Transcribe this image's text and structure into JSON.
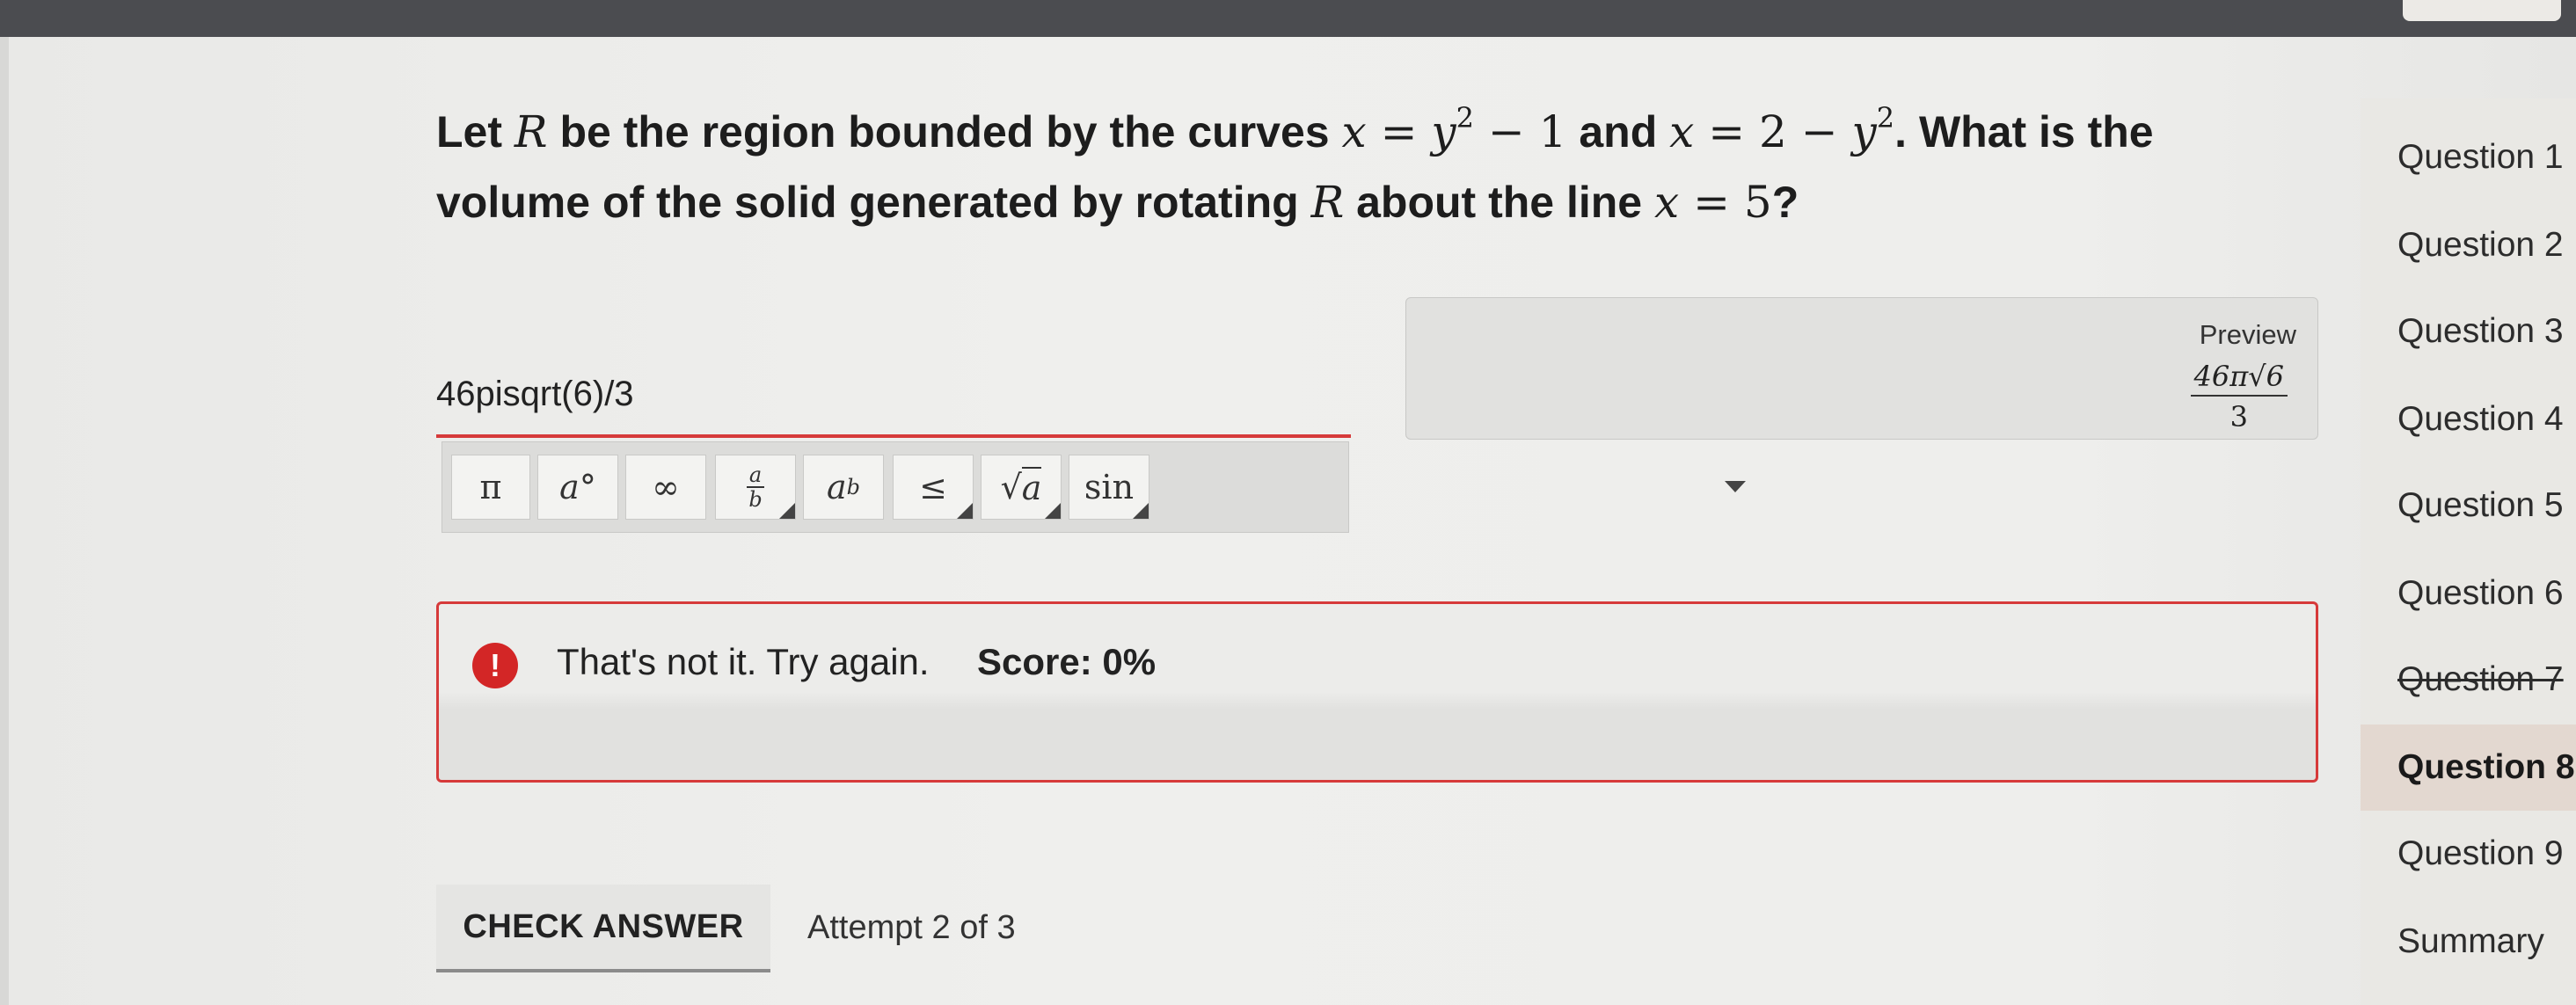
{
  "question": {
    "part1": "Let ",
    "var_R": "R",
    "part2": " be the region bounded by the curves ",
    "eq1_lhs": "x",
    "eq1_mid": " = ",
    "eq1_y": "y",
    "eq1_exp": "2",
    "eq1_rest": " − 1",
    "part3": " and ",
    "eq2_lhs": "x",
    "eq2_mid": " = 2 − ",
    "eq2_y": "y",
    "eq2_exp": "2",
    "part4": ". What is the",
    "part5": "volume of the solid generated by rotating ",
    "var_R2": "R",
    "part6": " about the line ",
    "eq3_lhs": "x",
    "eq3_rest": " = 5",
    "part7": "?"
  },
  "answer": {
    "value": "46pisqrt(6)/3"
  },
  "toolbar": {
    "pi": "π",
    "degree_base": "a",
    "degree_sym": "°",
    "infinity": "∞",
    "frac_num": "a",
    "frac_den": "b",
    "power_base": "a",
    "power_exp": "b",
    "leq": "≤",
    "sqrt_sym": "√",
    "sqrt_arg": "a",
    "sin": "sin"
  },
  "preview": {
    "label": "Preview",
    "numerator": "46π√6",
    "denominator": "3"
  },
  "feedback": {
    "icon": "!",
    "message": "That's not it. Try again.",
    "score": "Score: 0%"
  },
  "actions": {
    "check_answer": "CHECK ANSWER",
    "attempt": "Attempt 2 of 3"
  },
  "nav": {
    "items": [
      {
        "label": "Question 1"
      },
      {
        "label": "Question 2"
      },
      {
        "label": "Question 3"
      },
      {
        "label": "Question 4"
      },
      {
        "label": "Question 5"
      },
      {
        "label": "Question 6"
      },
      {
        "label": "Question 7"
      },
      {
        "label": "Question 8"
      },
      {
        "label": "Question 9"
      },
      {
        "label": "Summary"
      }
    ],
    "current": "Question 8",
    "struck": "Question 7"
  },
  "colors": {
    "error_red": "#d63a3a",
    "alert_red": "#d32626",
    "current_nav_bg": "#e3d8d0"
  }
}
